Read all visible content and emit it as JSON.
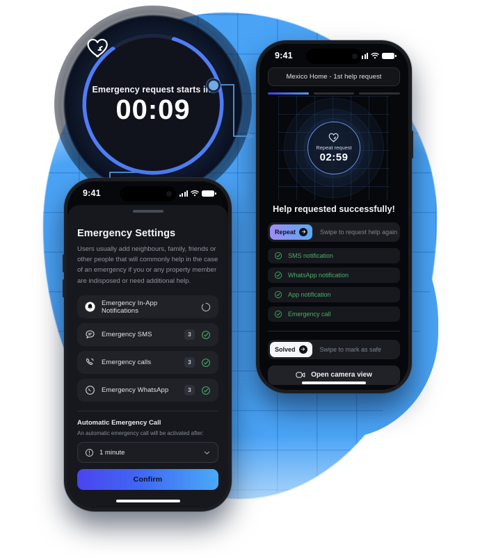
{
  "magnifier": {
    "heart_icon": "heart-pulse-icon",
    "label": "Emergency request starts in:",
    "time": "00:09",
    "progress_color": "#4f7df5",
    "track_color": "#1b2236"
  },
  "left_phone": {
    "status_bar": {
      "time": "9:41",
      "signal_icon": "cellular-bars-icon",
      "wifi_icon": "wifi-icon",
      "battery_icon": "battery-icon"
    },
    "title": "Emergency Settings",
    "description": "Users usually add neighbours, family, friends or other people that will commonly help in the case of an emergency if you or any property member are indisposed or need additional help.",
    "options": [
      {
        "icon": "in-app-notification-icon",
        "label": "Emergency In-App Notifications",
        "badge": "",
        "state": "loading"
      },
      {
        "icon": "sms-bubble-icon",
        "label": "Emergency SMS",
        "badge": "3",
        "state": "done"
      },
      {
        "icon": "phone-call-icon",
        "label": "Emergency calls",
        "badge": "3",
        "state": "done"
      },
      {
        "icon": "whatsapp-icon",
        "label": "Emergency WhatsApp",
        "badge": "3",
        "state": "done"
      }
    ],
    "auto_call": {
      "title": "Automatic Emergency Call",
      "subtitle": "An automatic emergency call will be activated after:",
      "select_icon": "clock-icon",
      "select_value": "1 minute",
      "chevron_icon": "chevron-down-icon"
    },
    "confirm_label": "Confirm"
  },
  "right_phone": {
    "status_bar": {
      "time": "9:41",
      "signal_icon": "cellular-bars-icon",
      "wifi_icon": "wifi-icon",
      "battery_icon": "battery-icon"
    },
    "title_pill": "Mexico Home - 1st help request",
    "steps": {
      "total": 3,
      "active": 1
    },
    "repeat_circle": {
      "heart_icon": "heart-pulse-icon",
      "label": "Repeat request",
      "time": "02:59"
    },
    "success_text": "Help requested successfully!",
    "repeat_swipe": {
      "button_label": "Repeat",
      "arrow_icon": "arrow-right-icon",
      "hint": "Swipe to request help again"
    },
    "notifications": [
      {
        "icon": "check-circle-icon",
        "label": "SMS notification"
      },
      {
        "icon": "check-circle-icon",
        "label": "WhatsApp notification"
      },
      {
        "icon": "check-circle-icon",
        "label": "App notification"
      },
      {
        "icon": "check-circle-icon",
        "label": "Emergency call"
      }
    ],
    "solved_swipe": {
      "button_label": "Solved",
      "arrow_icon": "arrow-right-icon",
      "hint": "Swipe to mark as safe"
    },
    "camera_button": {
      "icon": "video-camera-icon",
      "label": "Open camera view"
    }
  },
  "colors": {
    "background_blue": "#4aa3f5",
    "accent_blue": "#4f7df5",
    "success_green": "#4cae6a",
    "dark_surface": "#16181e"
  }
}
